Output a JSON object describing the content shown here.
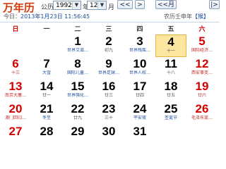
{
  "header": {
    "logo": "万年历",
    "calendar_label": "公历",
    "year_value": "1992",
    "year_unit": "年",
    "month_value": "12",
    "month_unit": "月",
    "nav": [
      "<<",
      ">",
      "<<月",
      "|>"
    ],
    "today_prefix": "今日：",
    "today_stamp": "2013年1月23日 11:56:45",
    "lunar_year": "农历壬申年",
    "lunar_link": "【猴】"
  },
  "weekdays": [
    "日",
    "一",
    "二",
    "三",
    "四",
    "五",
    "六"
  ],
  "rows": [
    [
      {
        "num": "",
        "sub": ""
      },
      {
        "num": "",
        "sub": ""
      },
      {
        "num": "1",
        "sub": "世界艾滋…"
      },
      {
        "num": "2",
        "sub": "初九"
      },
      {
        "num": "3",
        "sub": "世界残疾…"
      },
      {
        "num": "4",
        "sub": "十一"
      },
      {
        "num": "5",
        "sub": "国际经济…"
      }
    ],
    [
      {
        "num": "6",
        "sub": "十三"
      },
      {
        "num": "7",
        "sub": "大雪"
      },
      {
        "num": "8",
        "sub": "国际儿童…"
      },
      {
        "num": "9",
        "sub": "世界足球…"
      },
      {
        "num": "10",
        "sub": "世界人权…"
      },
      {
        "num": "11",
        "sub": "十八"
      },
      {
        "num": "12",
        "sub": "西安事变…"
      }
    ],
    [
      {
        "num": "13",
        "sub": "南京大屠…"
      },
      {
        "num": "14",
        "sub": "廿一"
      },
      {
        "num": "15",
        "sub": "世界强化…"
      },
      {
        "num": "16",
        "sub": "廿三"
      },
      {
        "num": "17",
        "sub": "廿四"
      },
      {
        "num": "18",
        "sub": "廿五"
      },
      {
        "num": "19",
        "sub": "廿六"
      }
    ],
    [
      {
        "num": "20",
        "sub": "澳门回归…"
      },
      {
        "num": "21",
        "sub": "冬至"
      },
      {
        "num": "22",
        "sub": "廿九"
      },
      {
        "num": "23",
        "sub": "三十"
      },
      {
        "num": "24",
        "sub": "平安夜"
      },
      {
        "num": "25",
        "sub": "圣诞节"
      },
      {
        "num": "26",
        "sub": "毛泽东诞…"
      }
    ],
    [
      {
        "num": "27",
        "sub": ""
      },
      {
        "num": "28",
        "sub": ""
      },
      {
        "num": "29",
        "sub": ""
      },
      {
        "num": "30",
        "sub": ""
      },
      {
        "num": "31",
        "sub": ""
      },
      {
        "num": "",
        "sub": ""
      },
      {
        "num": "",
        "sub": ""
      }
    ]
  ],
  "highlight": {
    "today_num": "4"
  },
  "colors": {
    "weekend": "#d40000",
    "festival": "#1a4a9a",
    "today_bg": "#fde6a0",
    "logo": "#d23a0c"
  }
}
